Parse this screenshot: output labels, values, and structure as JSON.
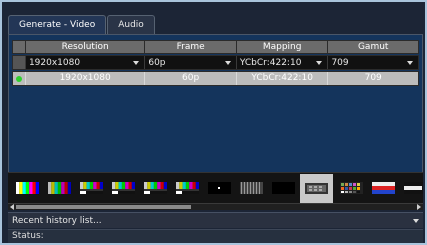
{
  "tabs": [
    {
      "label": "Generate - Video",
      "active": true
    },
    {
      "label": "Audio",
      "active": false
    }
  ],
  "table": {
    "headers": [
      "",
      "Resolution",
      "Frame",
      "Mapping",
      "Gamut"
    ],
    "selectors": {
      "resolution": "1920x1080",
      "frame": "60p",
      "mapping": "YCbCr:422:10",
      "gamut": "709"
    },
    "rows": [
      {
        "active": true,
        "resolution": "1920x1080",
        "frame": "60p",
        "mapping": "YCbCr:422:10",
        "gamut": "709"
      }
    ]
  },
  "patterns": [
    {
      "icon": "color-bars-pattern-icon"
    },
    {
      "icon": "color-bars-pattern-icon"
    },
    {
      "icon": "smpte-bars-pattern-icon"
    },
    {
      "icon": "smpte-bars-pattern-icon"
    },
    {
      "icon": "smpte-bars-pattern-icon"
    },
    {
      "icon": "smpte-bars-pattern-icon"
    },
    {
      "icon": "pluge-dot-pattern-icon"
    },
    {
      "icon": "multiburst-pattern-icon"
    },
    {
      "icon": "black-pattern-icon"
    },
    {
      "icon": "test-card-pattern-icon",
      "selected": true
    },
    {
      "icon": "color-checker-pattern-icon"
    },
    {
      "icon": "ramp-pattern-icon"
    },
    {
      "icon": "color-bars-pattern-icon"
    }
  ],
  "history": {
    "label": "Recent history list..."
  },
  "status": {
    "label": "Status:"
  },
  "colors": {
    "accent": "#2ed02e",
    "panel": "#14345c",
    "frame": "#a9c4dc"
  }
}
